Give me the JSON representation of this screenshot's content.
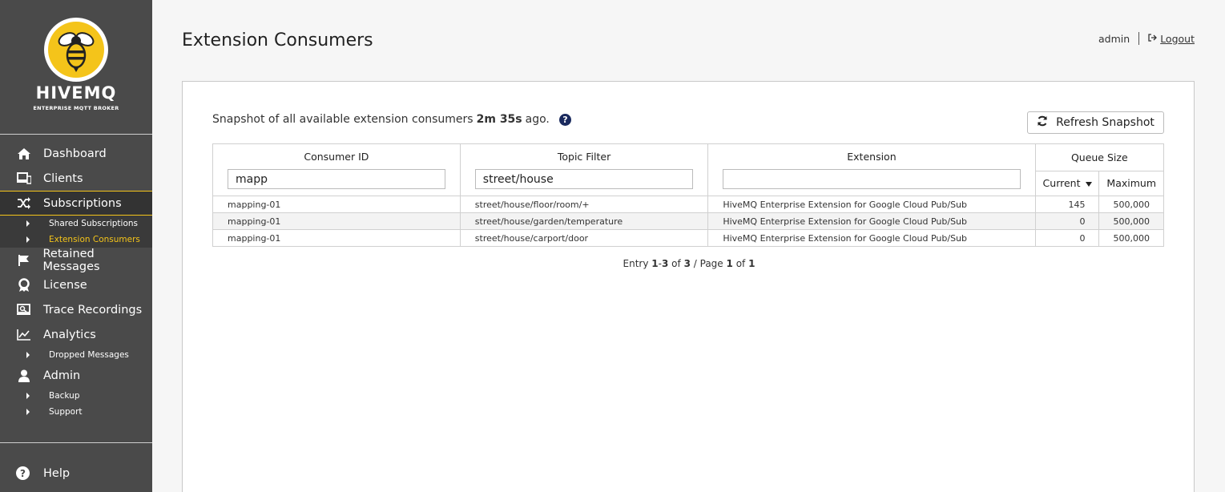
{
  "brand": {
    "name": "HIVEMQ",
    "tagline": "ENTERPRISE MQTT BROKER",
    "accent": "#f4c41a"
  },
  "sidebar": {
    "items": [
      {
        "label": "Dashboard",
        "icon": "home-icon"
      },
      {
        "label": "Clients",
        "icon": "devices-icon"
      },
      {
        "label": "Subscriptions",
        "icon": "shuffle-icon"
      },
      {
        "label": "Retained Messages",
        "icon": "flag-icon"
      },
      {
        "label": "License",
        "icon": "award-icon"
      },
      {
        "label": "Trace Recordings",
        "icon": "trace-icon"
      },
      {
        "label": "Analytics",
        "icon": "chart-icon"
      },
      {
        "label": "Admin",
        "icon": "user-icon"
      }
    ],
    "subscriptions_sub": [
      "Shared Subscriptions",
      "Extension Consumers"
    ],
    "analytics_sub": [
      "Dropped Messages"
    ],
    "admin_sub": [
      "Backup",
      "Support"
    ],
    "help": "Help"
  },
  "header": {
    "title": "Extension Consumers",
    "user": "admin",
    "logout": "Logout"
  },
  "snapshot": {
    "prefix": "Snapshot of all available extension consumers",
    "age": "2m 35s",
    "suffix": "ago.",
    "refresh_label": "Refresh Snapshot"
  },
  "table": {
    "headers": {
      "consumer_id": "Consumer ID",
      "topic_filter": "Topic Filter",
      "extension": "Extension",
      "queue_size": "Queue Size",
      "current": "Current",
      "maximum": "Maximum"
    },
    "filters": {
      "consumer_id": "mapp",
      "topic_filter": "street/house",
      "extension": ""
    },
    "rows": [
      {
        "consumer_id": "mapping-01",
        "topic_filter": "street/house/floor/room/+",
        "extension": "HiveMQ Enterprise Extension for Google Cloud Pub/Sub",
        "current": "145",
        "maximum": "500,000"
      },
      {
        "consumer_id": "mapping-01",
        "topic_filter": "street/house/garden/temperature",
        "extension": "HiveMQ Enterprise Extension for Google Cloud Pub/Sub",
        "current": "0",
        "maximum": "500,000"
      },
      {
        "consumer_id": "mapping-01",
        "topic_filter": "street/house/carport/door",
        "extension": "HiveMQ Enterprise Extension for Google Cloud Pub/Sub",
        "current": "0",
        "maximum": "500,000"
      }
    ]
  },
  "pager": {
    "entry_label": "Entry",
    "range_start": "1",
    "range_end": "3",
    "of_label": "of",
    "total": "3",
    "page_label": "/ Page",
    "page": "1",
    "page_of": "of",
    "pages": "1"
  }
}
